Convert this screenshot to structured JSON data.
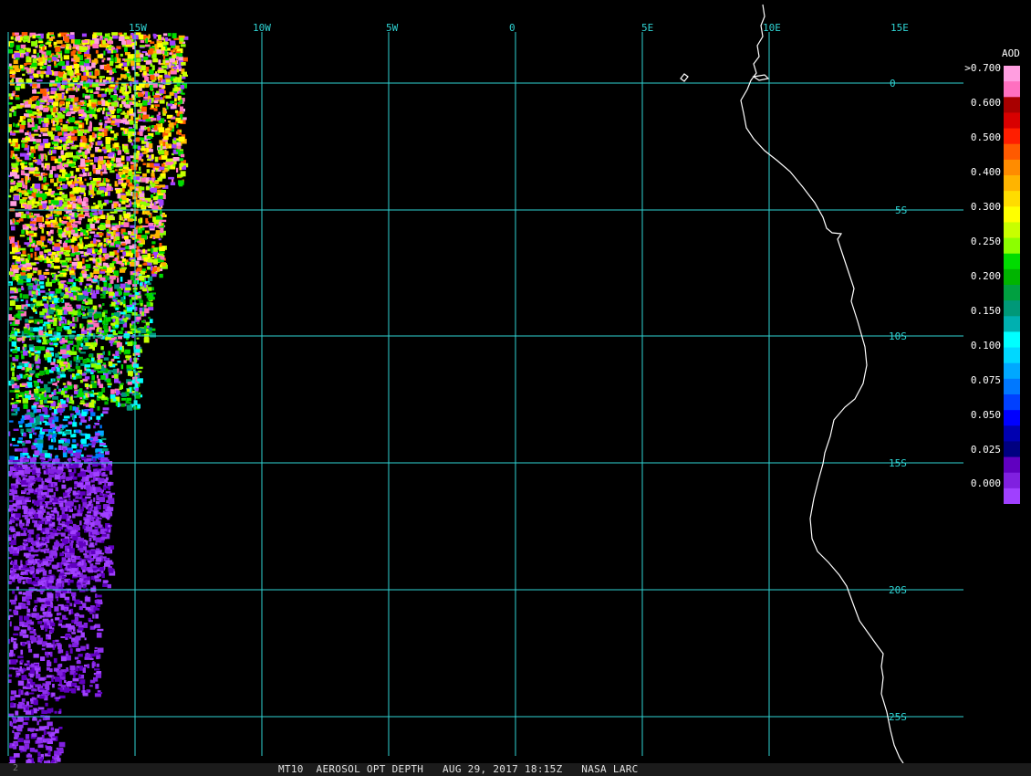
{
  "map": {
    "lon_labels": [
      "15W",
      "10W",
      "5W",
      "0",
      "5E",
      "10E",
      "15E"
    ],
    "lat_labels": [
      "0",
      "5S",
      "10S",
      "15S",
      "20S",
      "25S"
    ]
  },
  "legend": {
    "title": "AOD",
    "labels": [
      ">0.700",
      "0.600",
      "0.500",
      "0.400",
      "0.300",
      "0.250",
      "0.200",
      "0.150",
      "0.100",
      "0.075",
      "0.050",
      "0.025",
      "0.000"
    ],
    "colors": [
      "#ff9ee0",
      "#ff70c0",
      "#a80000",
      "#d80000",
      "#ff1e00",
      "#ff5a00",
      "#ff8c00",
      "#ffb400",
      "#ffdc00",
      "#ffff00",
      "#c8ff00",
      "#8cff00",
      "#00dc00",
      "#00b400",
      "#00a040",
      "#009878",
      "#00b0b0",
      "#00ffff",
      "#00d8ff",
      "#00a8ff",
      "#0078ff",
      "#0040ff",
      "#0000ff",
      "#0000b0",
      "#000080",
      "#6000c0",
      "#8020e0",
      "#a040ff"
    ]
  },
  "caption": "MT10  AEROSOL OPT DEPTH   AUG 29, 2017 18:15Z   NASA LARC",
  "corner_mark": "2"
}
